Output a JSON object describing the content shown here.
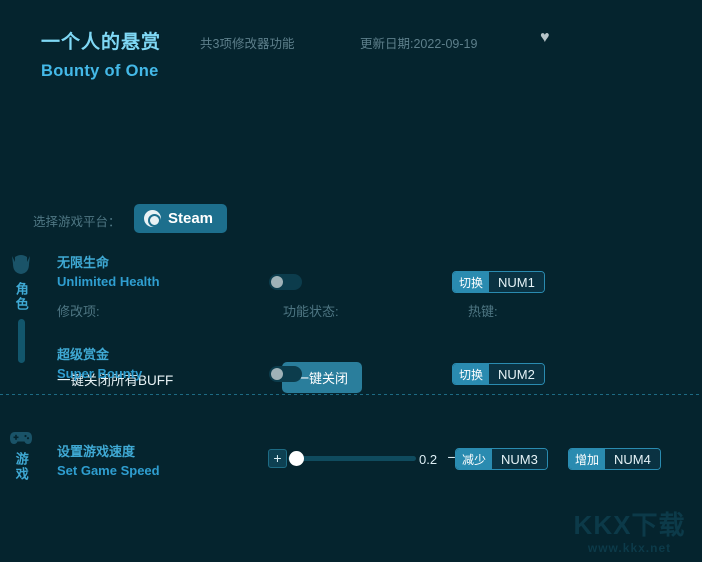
{
  "header": {
    "title_cn": "一个人的悬赏",
    "title_en": "Bounty of One",
    "feature_count": "共3项修改器功能",
    "update_date": "更新日期:2022-09-19",
    "favorite_icon": "♥"
  },
  "platform": {
    "label": "选择游戏平台：",
    "selected": "Steam",
    "icon": "steam-icon"
  },
  "columns": {
    "name": "修改项:",
    "status": "功能状态:",
    "hotkey": "热键:"
  },
  "master": {
    "label": "一键关闭所有BUFF",
    "button": "一键关闭"
  },
  "sections": [
    {
      "side_label": "角色",
      "icon": "helmet-icon",
      "rows": [
        {
          "name_cn": "无限生命",
          "name_en": "Unlimited Health",
          "toggle_state": "off",
          "hotkey_action": "切换",
          "hotkey_key": "NUM1"
        },
        {
          "name_cn": "超级赏金",
          "name_en": "Super Bounty",
          "toggle_state": "off",
          "hotkey_action": "切换",
          "hotkey_key": "NUM2"
        }
      ]
    },
    {
      "side_label": "游戏",
      "icon": "gamepad-icon",
      "rows": [
        {
          "name_cn": "设置游戏速度",
          "name_en": "Set Game Speed",
          "value": "0.2",
          "increase_symbol": "+",
          "decrease_symbol": "−",
          "hotkey_dec_action": "减少",
          "hotkey_dec_key": "NUM3",
          "hotkey_inc_action": "增加",
          "hotkey_inc_key": "NUM4"
        }
      ]
    }
  ],
  "watermark": {
    "main": "KKX下载",
    "sub": "www.kkx.net"
  },
  "colors": {
    "background": "#05242e",
    "accent": "#2a8bb0",
    "title": "#7fd8f5",
    "muted": "#4e7683"
  }
}
